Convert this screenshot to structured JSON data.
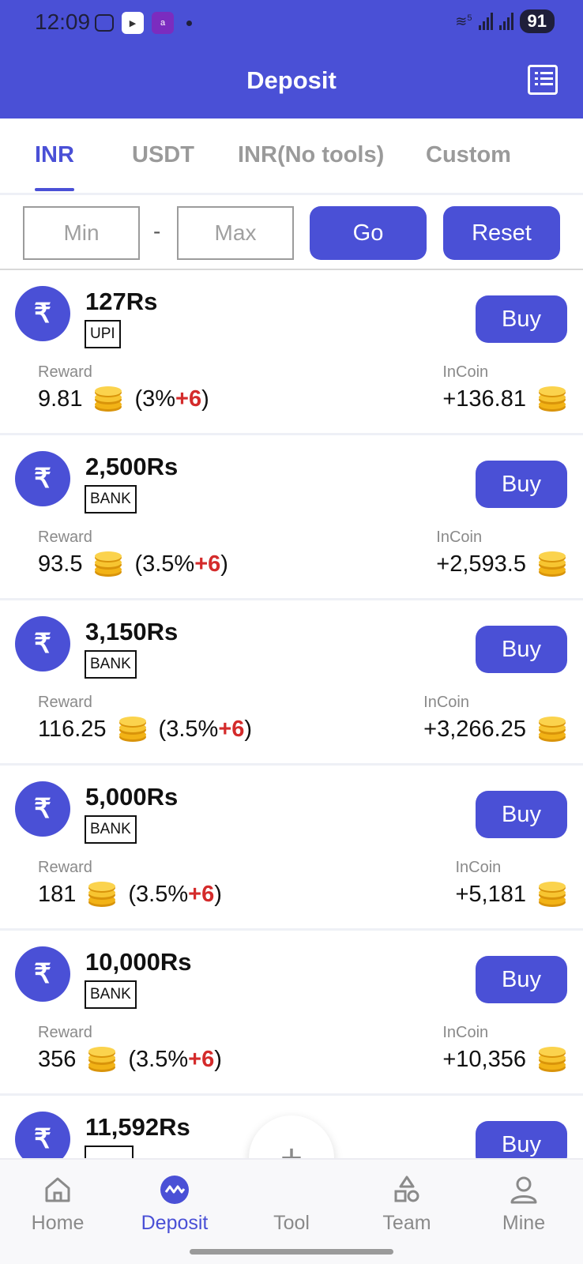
{
  "status_bar": {
    "time": "12:09",
    "battery": "91",
    "wifi_badge": "5"
  },
  "header": {
    "title": "Deposit"
  },
  "tabs": [
    {
      "label": "INR",
      "active": true
    },
    {
      "label": "USDT",
      "active": false
    },
    {
      "label": "INR(No tools)",
      "active": false
    },
    {
      "label": "Custom",
      "active": false
    }
  ],
  "filter": {
    "min_placeholder": "Min",
    "separator": "-",
    "max_placeholder": "Max",
    "go_label": "Go",
    "reset_label": "Reset"
  },
  "items": [
    {
      "amount": "127Rs",
      "method": "UPI",
      "reward_label": "Reward",
      "reward_value": "9.81",
      "reward_rate": "(3%",
      "reward_bonus": "+6",
      "reward_close": ")",
      "incoin_label": "InCoin",
      "incoin_value": "+136.81",
      "buy_label": "Buy"
    },
    {
      "amount": "2,500Rs",
      "method": "BANK",
      "reward_label": "Reward",
      "reward_value": "93.5",
      "reward_rate": "(3.5%",
      "reward_bonus": "+6",
      "reward_close": ")",
      "incoin_label": "InCoin",
      "incoin_value": "+2,593.5",
      "buy_label": "Buy"
    },
    {
      "amount": "3,150Rs",
      "method": "BANK",
      "reward_label": "Reward",
      "reward_value": "116.25",
      "reward_rate": "(3.5%",
      "reward_bonus": "+6",
      "reward_close": ")",
      "incoin_label": "InCoin",
      "incoin_value": "+3,266.25",
      "buy_label": "Buy"
    },
    {
      "amount": "5,000Rs",
      "method": "BANK",
      "reward_label": "Reward",
      "reward_value": "181",
      "reward_rate": "(3.5%",
      "reward_bonus": "+6",
      "reward_close": ")",
      "incoin_label": "InCoin",
      "incoin_value": "+5,181",
      "buy_label": "Buy"
    },
    {
      "amount": "10,000Rs",
      "method": "BANK",
      "reward_label": "Reward",
      "reward_value": "356",
      "reward_rate": "(3.5%",
      "reward_bonus": "+6",
      "reward_close": ")",
      "incoin_label": "InCoin",
      "incoin_value": "+10,356",
      "buy_label": "Buy"
    },
    {
      "amount": "11,592Rs",
      "method": "",
      "reward_label": "",
      "reward_value": "",
      "reward_rate": "",
      "reward_bonus": "",
      "reward_close": "",
      "incoin_label": "",
      "incoin_value": "",
      "buy_label": "Buy"
    }
  ],
  "nav": [
    {
      "label": "Home",
      "icon": "home-icon",
      "active": false
    },
    {
      "label": "Deposit",
      "icon": "deposit-icon",
      "active": true
    },
    {
      "label": "Tool",
      "icon": "plus-icon",
      "active": false
    },
    {
      "label": "Team",
      "icon": "shapes-icon",
      "active": false
    },
    {
      "label": "Mine",
      "icon": "user-icon",
      "active": false
    }
  ],
  "colors": {
    "primary": "#4a50d6",
    "bonus_red": "#d42b2b",
    "coin_gold": "#f2b316"
  }
}
